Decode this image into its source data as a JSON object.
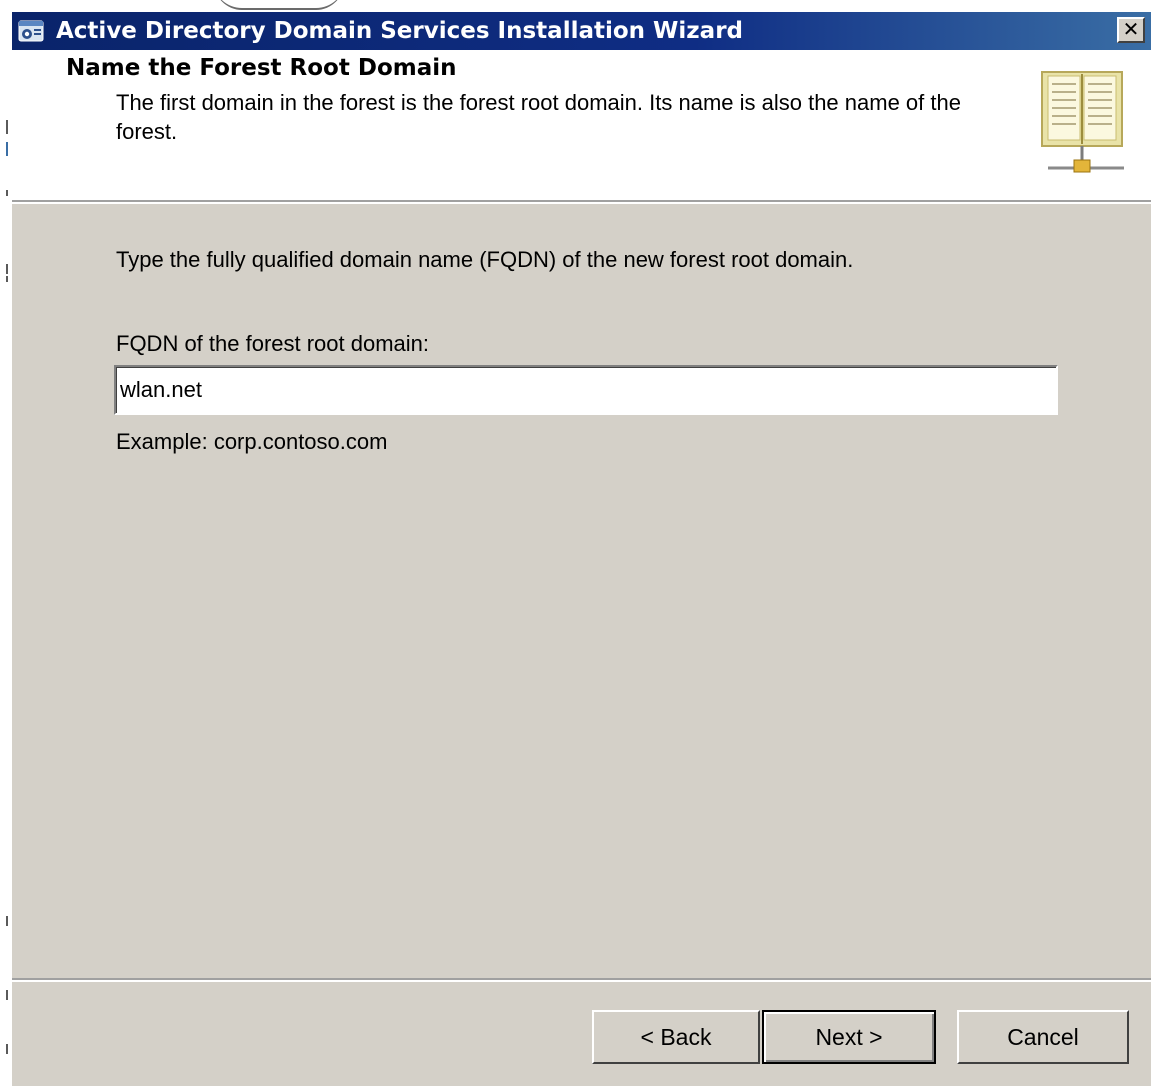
{
  "window": {
    "title": "Active Directory Domain Services Installation Wizard",
    "close_label": "✕"
  },
  "header": {
    "title": "Name the Forest Root Domain",
    "description": "The first domain in the forest is the forest root domain. Its name is also the name of the forest.",
    "icon": "directory-book-icon"
  },
  "content": {
    "instruction": "Type the fully qualified domain name (FQDN) of the new forest root domain.",
    "field_label": "FQDN of the forest root domain:",
    "field_value": "wlan.net",
    "example": "Example: corp.contoso.com"
  },
  "buttons": {
    "back": "< Back",
    "next": "Next >",
    "cancel": "Cancel"
  },
  "colors": {
    "titlebar": "#0a246a",
    "dialog_bg": "#d4d0c8",
    "header_bg": "#ffffff"
  }
}
